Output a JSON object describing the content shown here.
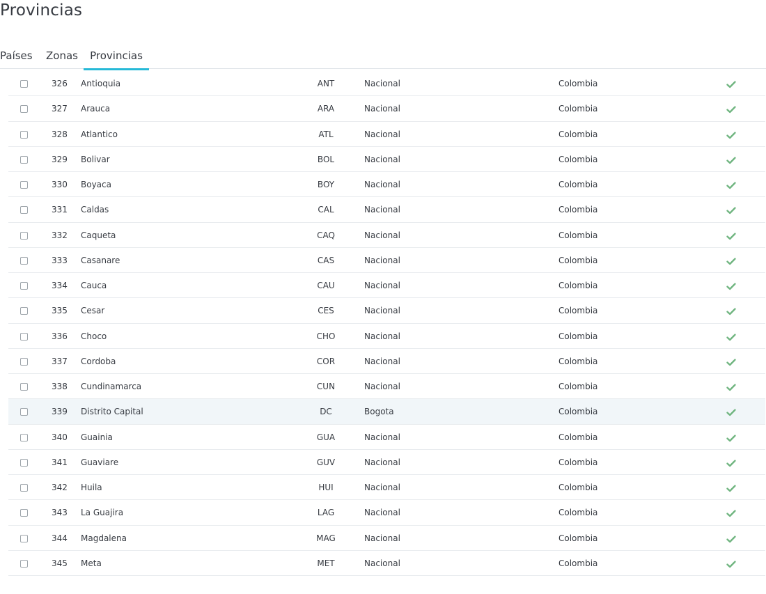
{
  "page": {
    "title": "Provincias"
  },
  "tabs": [
    {
      "label": "Países"
    },
    {
      "label": "Zonas"
    },
    {
      "label": "Provincias"
    }
  ],
  "colors": {
    "accent": "#25b9d7",
    "check": "#70b580",
    "row_highlight": "#f1f6f9"
  },
  "status_icon": "check-icon",
  "states": [
    {
      "id": "326",
      "name": "Antioquia",
      "iso": "ANT",
      "zone": "Nacional",
      "country": "Colombia"
    },
    {
      "id": "327",
      "name": "Arauca",
      "iso": "ARA",
      "zone": "Nacional",
      "country": "Colombia"
    },
    {
      "id": "328",
      "name": "Atlantico",
      "iso": "ATL",
      "zone": "Nacional",
      "country": "Colombia"
    },
    {
      "id": "329",
      "name": "Bolivar",
      "iso": "BOL",
      "zone": "Nacional",
      "country": "Colombia"
    },
    {
      "id": "330",
      "name": "Boyaca",
      "iso": "BOY",
      "zone": "Nacional",
      "country": "Colombia"
    },
    {
      "id": "331",
      "name": "Caldas",
      "iso": "CAL",
      "zone": "Nacional",
      "country": "Colombia"
    },
    {
      "id": "332",
      "name": "Caqueta",
      "iso": "CAQ",
      "zone": "Nacional",
      "country": "Colombia"
    },
    {
      "id": "333",
      "name": "Casanare",
      "iso": "CAS",
      "zone": "Nacional",
      "country": "Colombia"
    },
    {
      "id": "334",
      "name": "Cauca",
      "iso": "CAU",
      "zone": "Nacional",
      "country": "Colombia"
    },
    {
      "id": "335",
      "name": "Cesar",
      "iso": "CES",
      "zone": "Nacional",
      "country": "Colombia"
    },
    {
      "id": "336",
      "name": "Choco",
      "iso": "CHO",
      "zone": "Nacional",
      "country": "Colombia"
    },
    {
      "id": "337",
      "name": "Cordoba",
      "iso": "COR",
      "zone": "Nacional",
      "country": "Colombia"
    },
    {
      "id": "338",
      "name": "Cundinamarca",
      "iso": "CUN",
      "zone": "Nacional",
      "country": "Colombia"
    },
    {
      "id": "339",
      "name": "Distrito Capital",
      "iso": "DC",
      "zone": "Bogota",
      "country": "Colombia",
      "highlighted": true
    },
    {
      "id": "340",
      "name": "Guainia",
      "iso": "GUA",
      "zone": "Nacional",
      "country": "Colombia"
    },
    {
      "id": "341",
      "name": "Guaviare",
      "iso": "GUV",
      "zone": "Nacional",
      "country": "Colombia"
    },
    {
      "id": "342",
      "name": "Huila",
      "iso": "HUI",
      "zone": "Nacional",
      "country": "Colombia"
    },
    {
      "id": "343",
      "name": "La Guajira",
      "iso": "LAG",
      "zone": "Nacional",
      "country": "Colombia"
    },
    {
      "id": "344",
      "name": "Magdalena",
      "iso": "MAG",
      "zone": "Nacional",
      "country": "Colombia"
    },
    {
      "id": "345",
      "name": "Meta",
      "iso": "MET",
      "zone": "Nacional",
      "country": "Colombia"
    }
  ]
}
